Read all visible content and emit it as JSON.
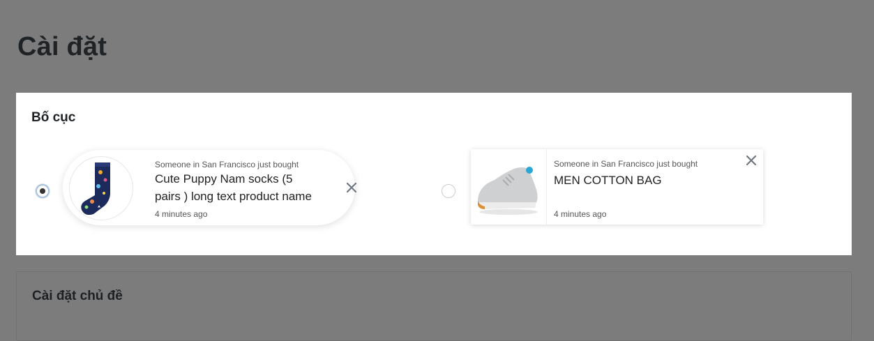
{
  "page": {
    "title": "Cài đặt"
  },
  "layout_card": {
    "heading": "Bố cục",
    "options": [
      {
        "selected": true,
        "meta": "Someone in San Francisco just bought",
        "product_line1": "Cute Puppy Nam socks (5",
        "product_line2": "pairs ) long text product name",
        "time": "4 minutes ago",
        "thumb_icon": "sock-image"
      },
      {
        "selected": false,
        "meta": "Someone in San Francisco just bought",
        "product_line1": "MEN COTTON BAG",
        "time": "4 minutes ago",
        "thumb_icon": "sneaker-image"
      }
    ]
  },
  "theme_card": {
    "heading": "Cài đặt chủ đề"
  },
  "colors": {
    "overlay": "#7c7c7c",
    "card": "#ffffff",
    "text": "#222222"
  }
}
